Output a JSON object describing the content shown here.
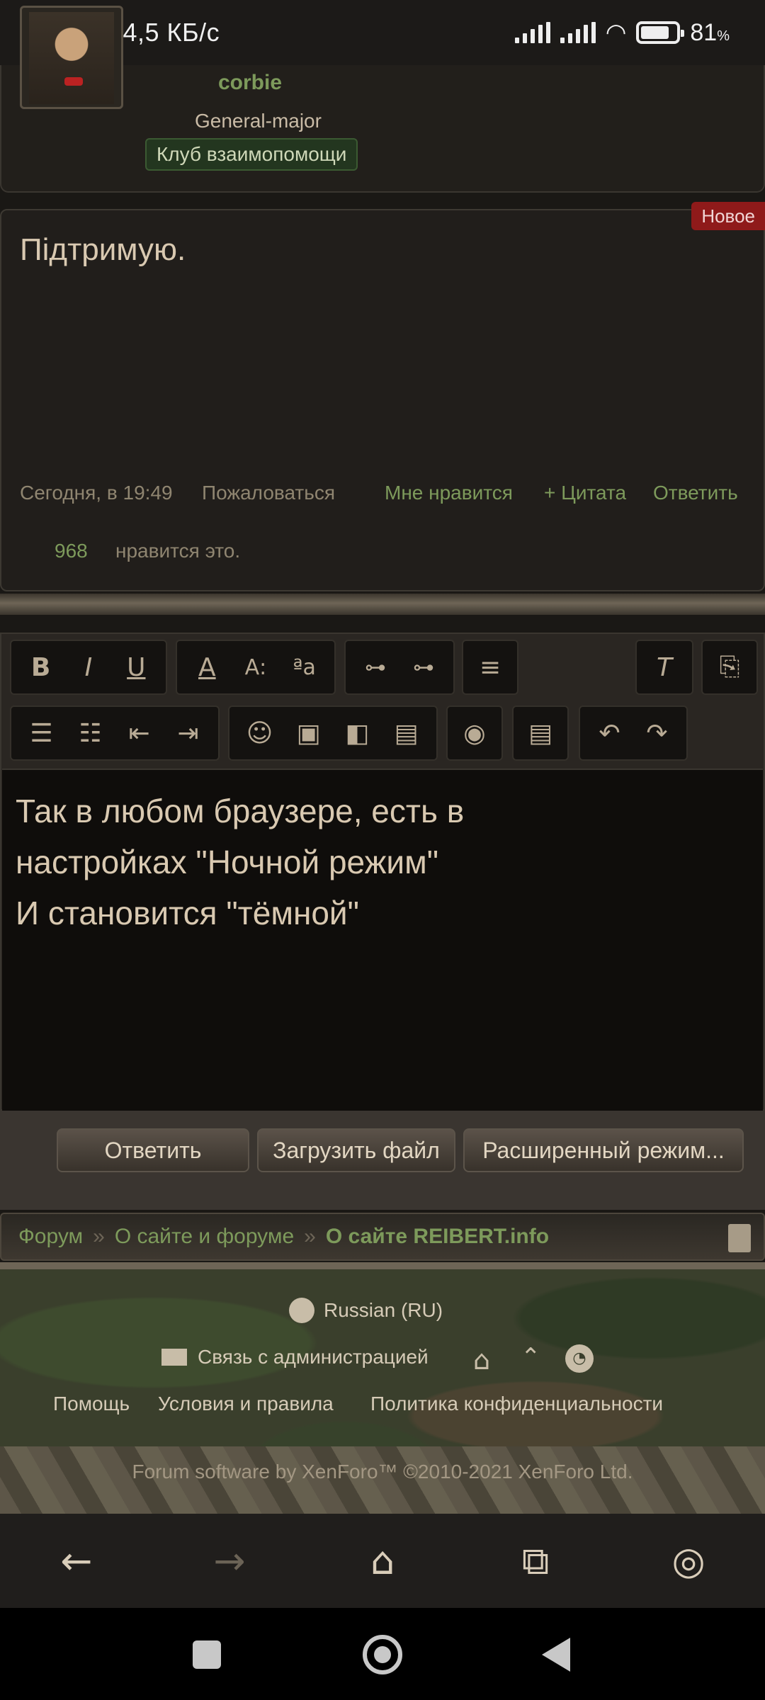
{
  "status": {
    "time_speed": "21:36 | 4,5 КБ/с",
    "battery": "81",
    "battery_unit": "%"
  },
  "post": {
    "username": "corbie",
    "rank": "General-major",
    "club": "Клуб взаимопомощи",
    "new_badge": "Новое",
    "text": "Підтримую.",
    "timestamp": "Сегодня, в 19:49",
    "report": "Пожаловаться",
    "like": "Мне нравится",
    "quote": "+ Цитата",
    "reply": "Ответить",
    "like_count": "968",
    "like_text": "нравится это."
  },
  "editor": {
    "lines": [
      "Так в любом браузере, есть  в",
      "настройках \"Ночной режим\"",
      "И становится \"тёмной\""
    ],
    "buttons": {
      "reply": "Ответить",
      "upload": "Загрузить файл",
      "advanced": "Расширенный режим..."
    }
  },
  "breadcrumb": {
    "items": [
      "Форум",
      "О сайте и форуме",
      "О сайте REIBERT.info"
    ],
    "separator": "»"
  },
  "footer": {
    "language": "Russian (RU)",
    "contact": "Связь с администрацией",
    "help": "Помощь",
    "terms": "Условия и правила",
    "privacy": "Политика конфиденциальности",
    "copyright": "Forum software by XenForo™ ©2010-2021 XenForo Ltd."
  },
  "colors": {
    "accent": "#7d9a5b",
    "badge": "#8f1a1a",
    "text": "#d9c9b1"
  }
}
